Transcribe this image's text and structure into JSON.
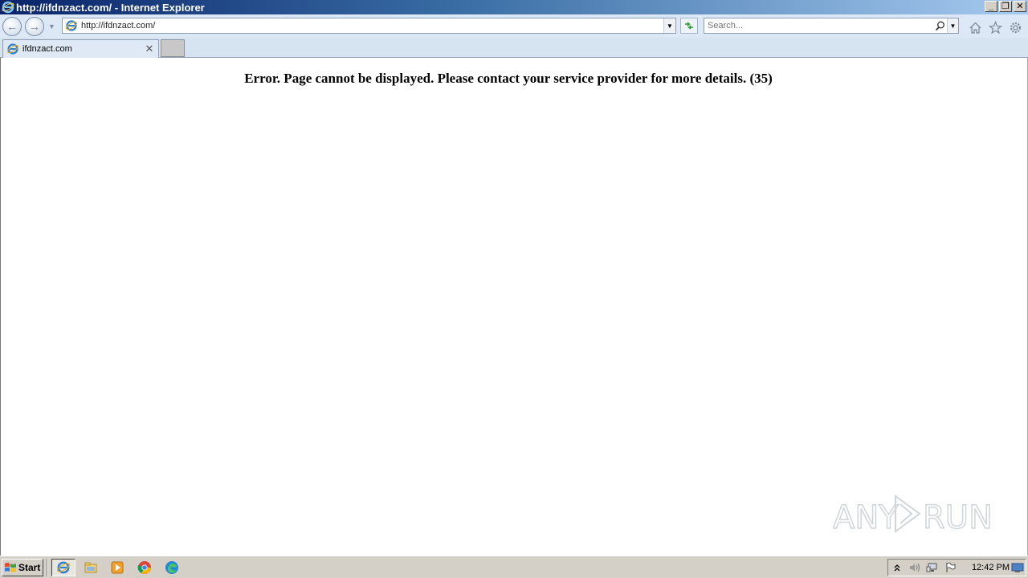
{
  "window": {
    "title": "http://ifdnzact.com/ - Internet Explorer",
    "minimize_glyph": "_",
    "restore_glyph": "❐",
    "close_glyph": "✕"
  },
  "navbar": {
    "back_glyph": "←",
    "forward_glyph": "→",
    "address_value": "http://ifdnzact.com/",
    "search_placeholder": "Search..."
  },
  "tabs": [
    {
      "label": "ifdnzact.com",
      "active": true
    }
  ],
  "content": {
    "error_message": "Error. Page cannot be displayed. Please contact your service provider for more details. (35)",
    "watermark": "ANY RUN"
  },
  "taskbar": {
    "start_label": "Start",
    "pinned_icons": [
      "internet-explorer-icon",
      "file-explorer-icon",
      "media-player-icon",
      "chrome-icon",
      "edge-icon"
    ],
    "clock": "12:42 PM"
  },
  "colors": {
    "titlebar_start": "#0a246a",
    "titlebar_end": "#a6caf0",
    "nav_bg": "#dce8f5",
    "taskbar_bg": "#d4d0c8"
  }
}
